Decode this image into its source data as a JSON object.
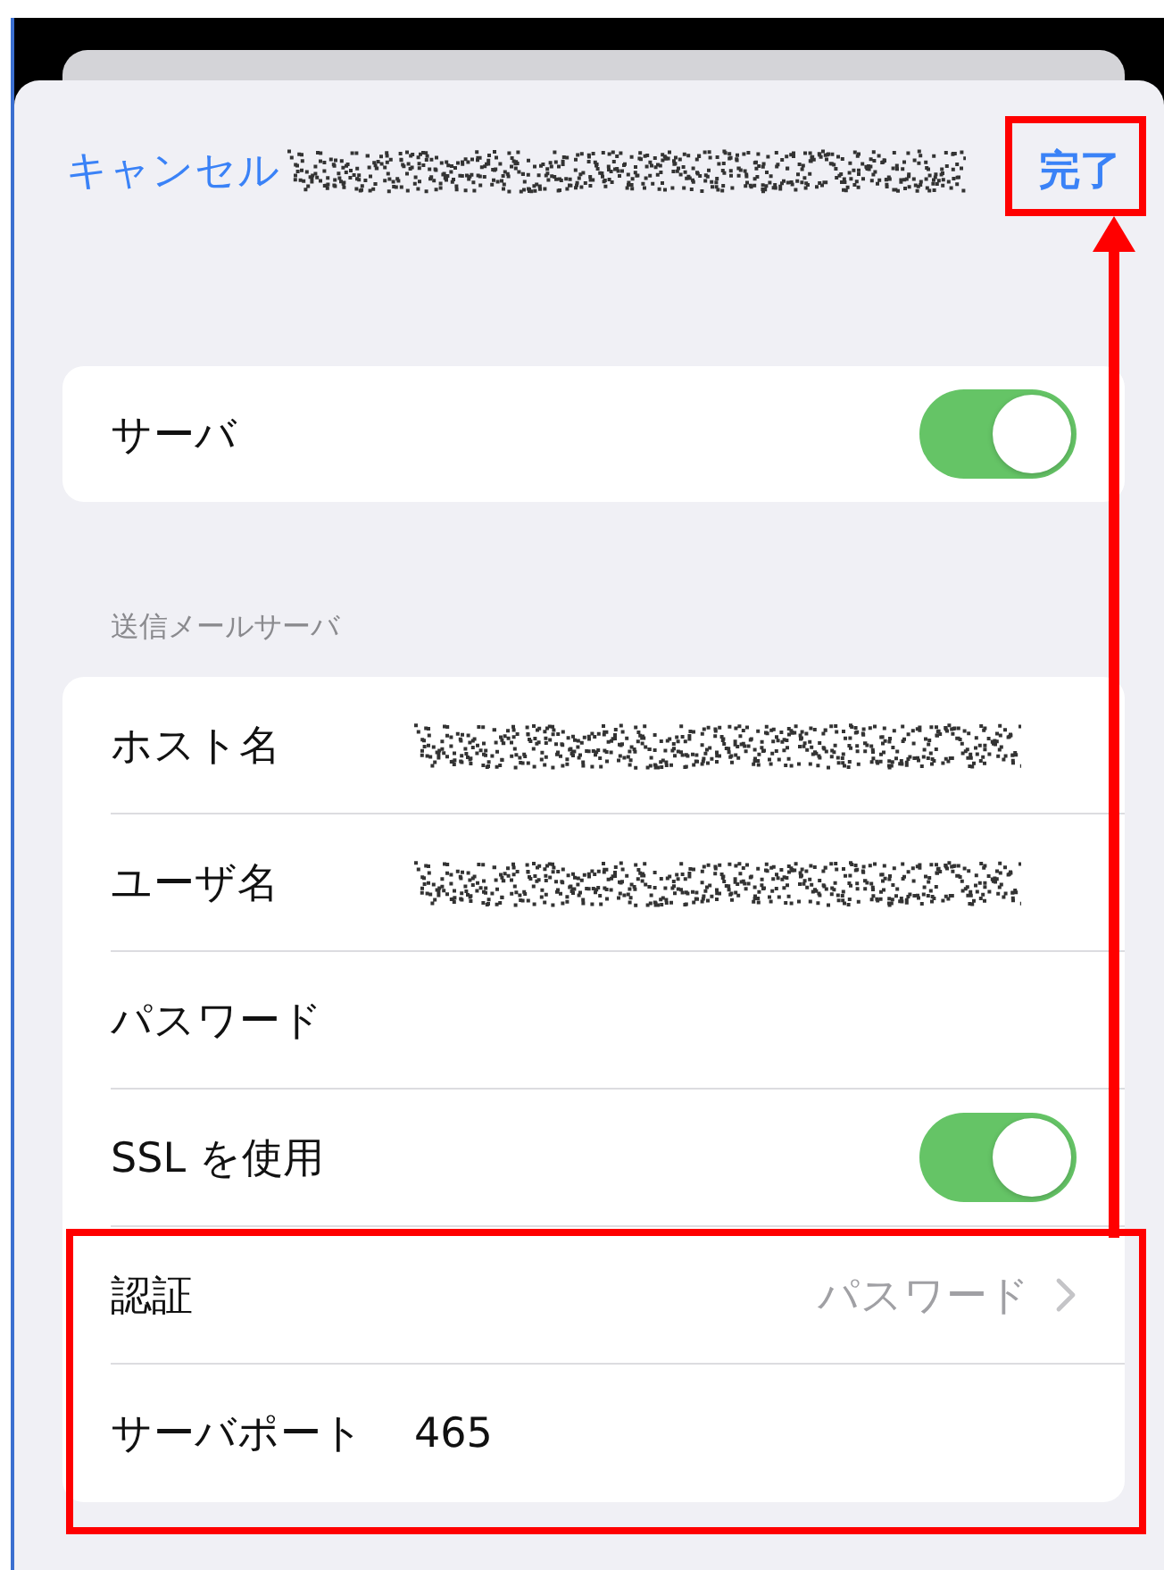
{
  "nav": {
    "cancel": "キャンセル",
    "title_redacted": true,
    "done": "完了"
  },
  "groups": [
    {
      "rows": [
        {
          "kind": "toggle",
          "label": "サーバ",
          "on": true
        }
      ]
    },
    {
      "header": "送信メールサーバ",
      "rows": [
        {
          "kind": "field",
          "label": "ホスト名",
          "redacted": true
        },
        {
          "kind": "field",
          "label": "ユーザ名",
          "redacted": true
        },
        {
          "kind": "field",
          "label": "パスワード",
          "redacted": false
        },
        {
          "kind": "toggle",
          "label": "SSL を使用",
          "on": true
        },
        {
          "kind": "link",
          "label": "認証",
          "value": "パスワード"
        },
        {
          "kind": "field",
          "label": "サーバポート",
          "value": "465",
          "redacted": false
        }
      ]
    }
  ]
}
